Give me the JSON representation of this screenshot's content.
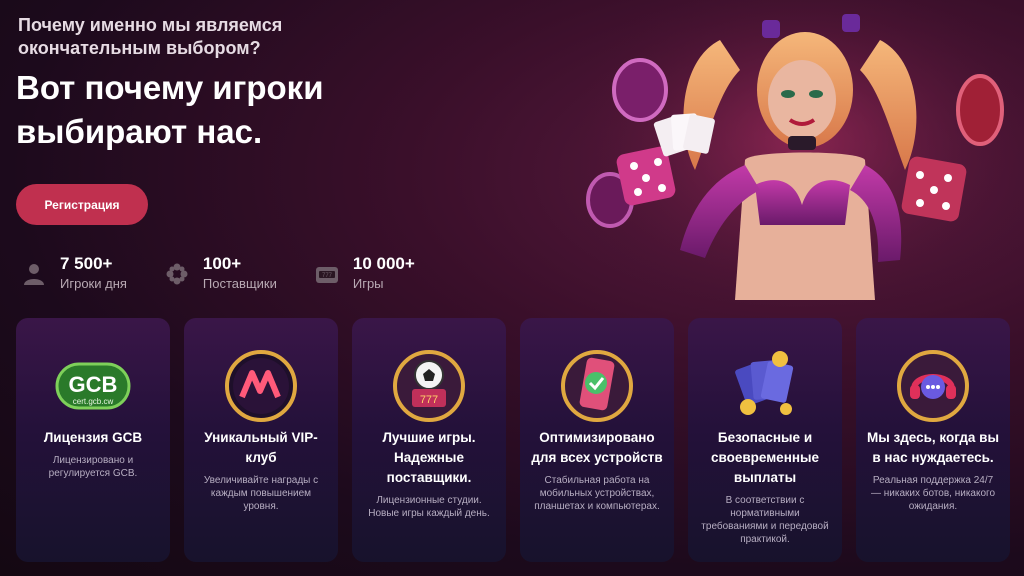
{
  "hero": {
    "subtitle": "Почему именно мы являемся окончательным выбором?",
    "title": "Вот почему игроки выбирают нас.",
    "register_label": "Регистрация"
  },
  "stats": [
    {
      "value": "7 500+",
      "label": "Игроки дня",
      "icon": "user-icon"
    },
    {
      "value": "100+",
      "label": "Поставщики",
      "icon": "providers-icon"
    },
    {
      "value": "10 000+",
      "label": "Игры",
      "icon": "slot-icon"
    }
  ],
  "cards": [
    {
      "title": "Лицензия GCB",
      "desc": "Лицензировано и регулируется GCB.",
      "icon": "gcb-logo",
      "logo_text": "GCB",
      "logo_sub": "cert.gcb.cw"
    },
    {
      "title": "Уникальный VIP-клуб",
      "desc": "Увеличивайте награды с каждым повышением уровня.",
      "icon": "vip-badge-icon"
    },
    {
      "title": "Лучшие игры. Надежные поставщики.",
      "desc": "Лицензионные студии. Новые игры каждый день.",
      "icon": "games-icon"
    },
    {
      "title": "Оптимизировано для всех устройств",
      "desc": "Стабильная работа на мобильных устройствах, планшетах и компьютерах.",
      "icon": "device-icon"
    },
    {
      "title": "Безопасные и своевременные выплаты",
      "desc": "В соответствии с нормативными требованиями и передовой практикой.",
      "icon": "payout-icon"
    },
    {
      "title": "Мы здесь, когда вы в нас нуждаетесь.",
      "desc": "Реальная поддержка 24/7 — никаких ботов, никакого ожидания.",
      "icon": "support-icon"
    }
  ],
  "colors": {
    "accent": "#c0304f",
    "background": "#1c0a1c"
  }
}
